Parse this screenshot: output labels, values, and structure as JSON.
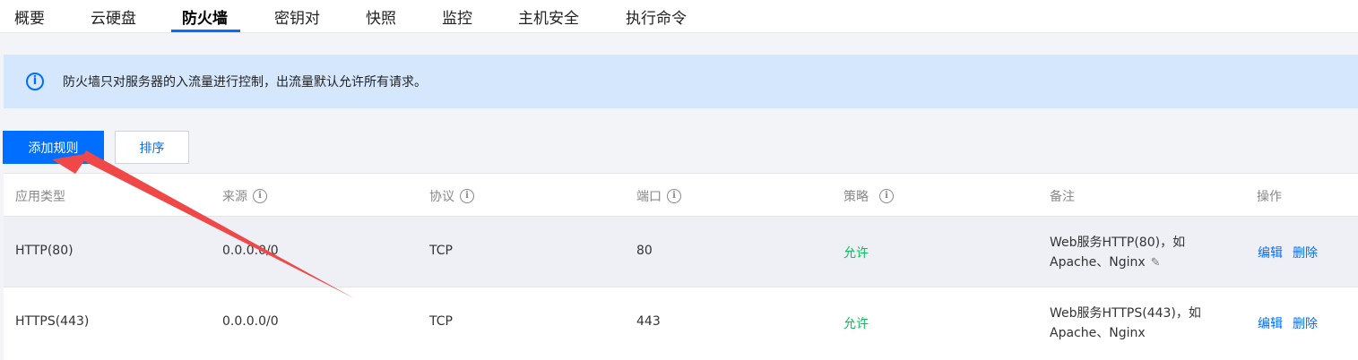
{
  "tabs": [
    "概要",
    "云硬盘",
    "防火墙",
    "密钥对",
    "快照",
    "监控",
    "主机安全",
    "执行命令"
  ],
  "active_tab": "防火墙",
  "notice": {
    "text": "防火墙只对服务器的入流量进行控制，出流量默认允许所有请求。",
    "icon": "info-icon"
  },
  "toolbar": {
    "add_label": "添加规则",
    "sort_label": "排序"
  },
  "table": {
    "headers": [
      "应用类型",
      "来源",
      "协议",
      "端口",
      "策略",
      "备注",
      "操作"
    ],
    "rows": [
      {
        "type": "HTTP(80)",
        "source": "0.0.0.0/0",
        "protocol": "TCP",
        "port": "80",
        "policy": "允许",
        "note_line1": "Web服务HTTP(80)，如",
        "note_line2": "Apache、Nginx",
        "edit": "编辑",
        "delete": "删除"
      },
      {
        "type": "HTTPS(443)",
        "source": "0.0.0.0/0",
        "protocol": "TCP",
        "port": "443",
        "policy": "允许",
        "note_line1": "Web服务HTTPS(443)，如",
        "note_line2": "Apache、Nginx",
        "edit": "编辑",
        "delete": "删除"
      }
    ]
  },
  "colors": {
    "accent": "#006eff",
    "allow": "#0abf5b",
    "notice_bg": "#d5e7fd",
    "annotation_arrow": "#f04848"
  }
}
